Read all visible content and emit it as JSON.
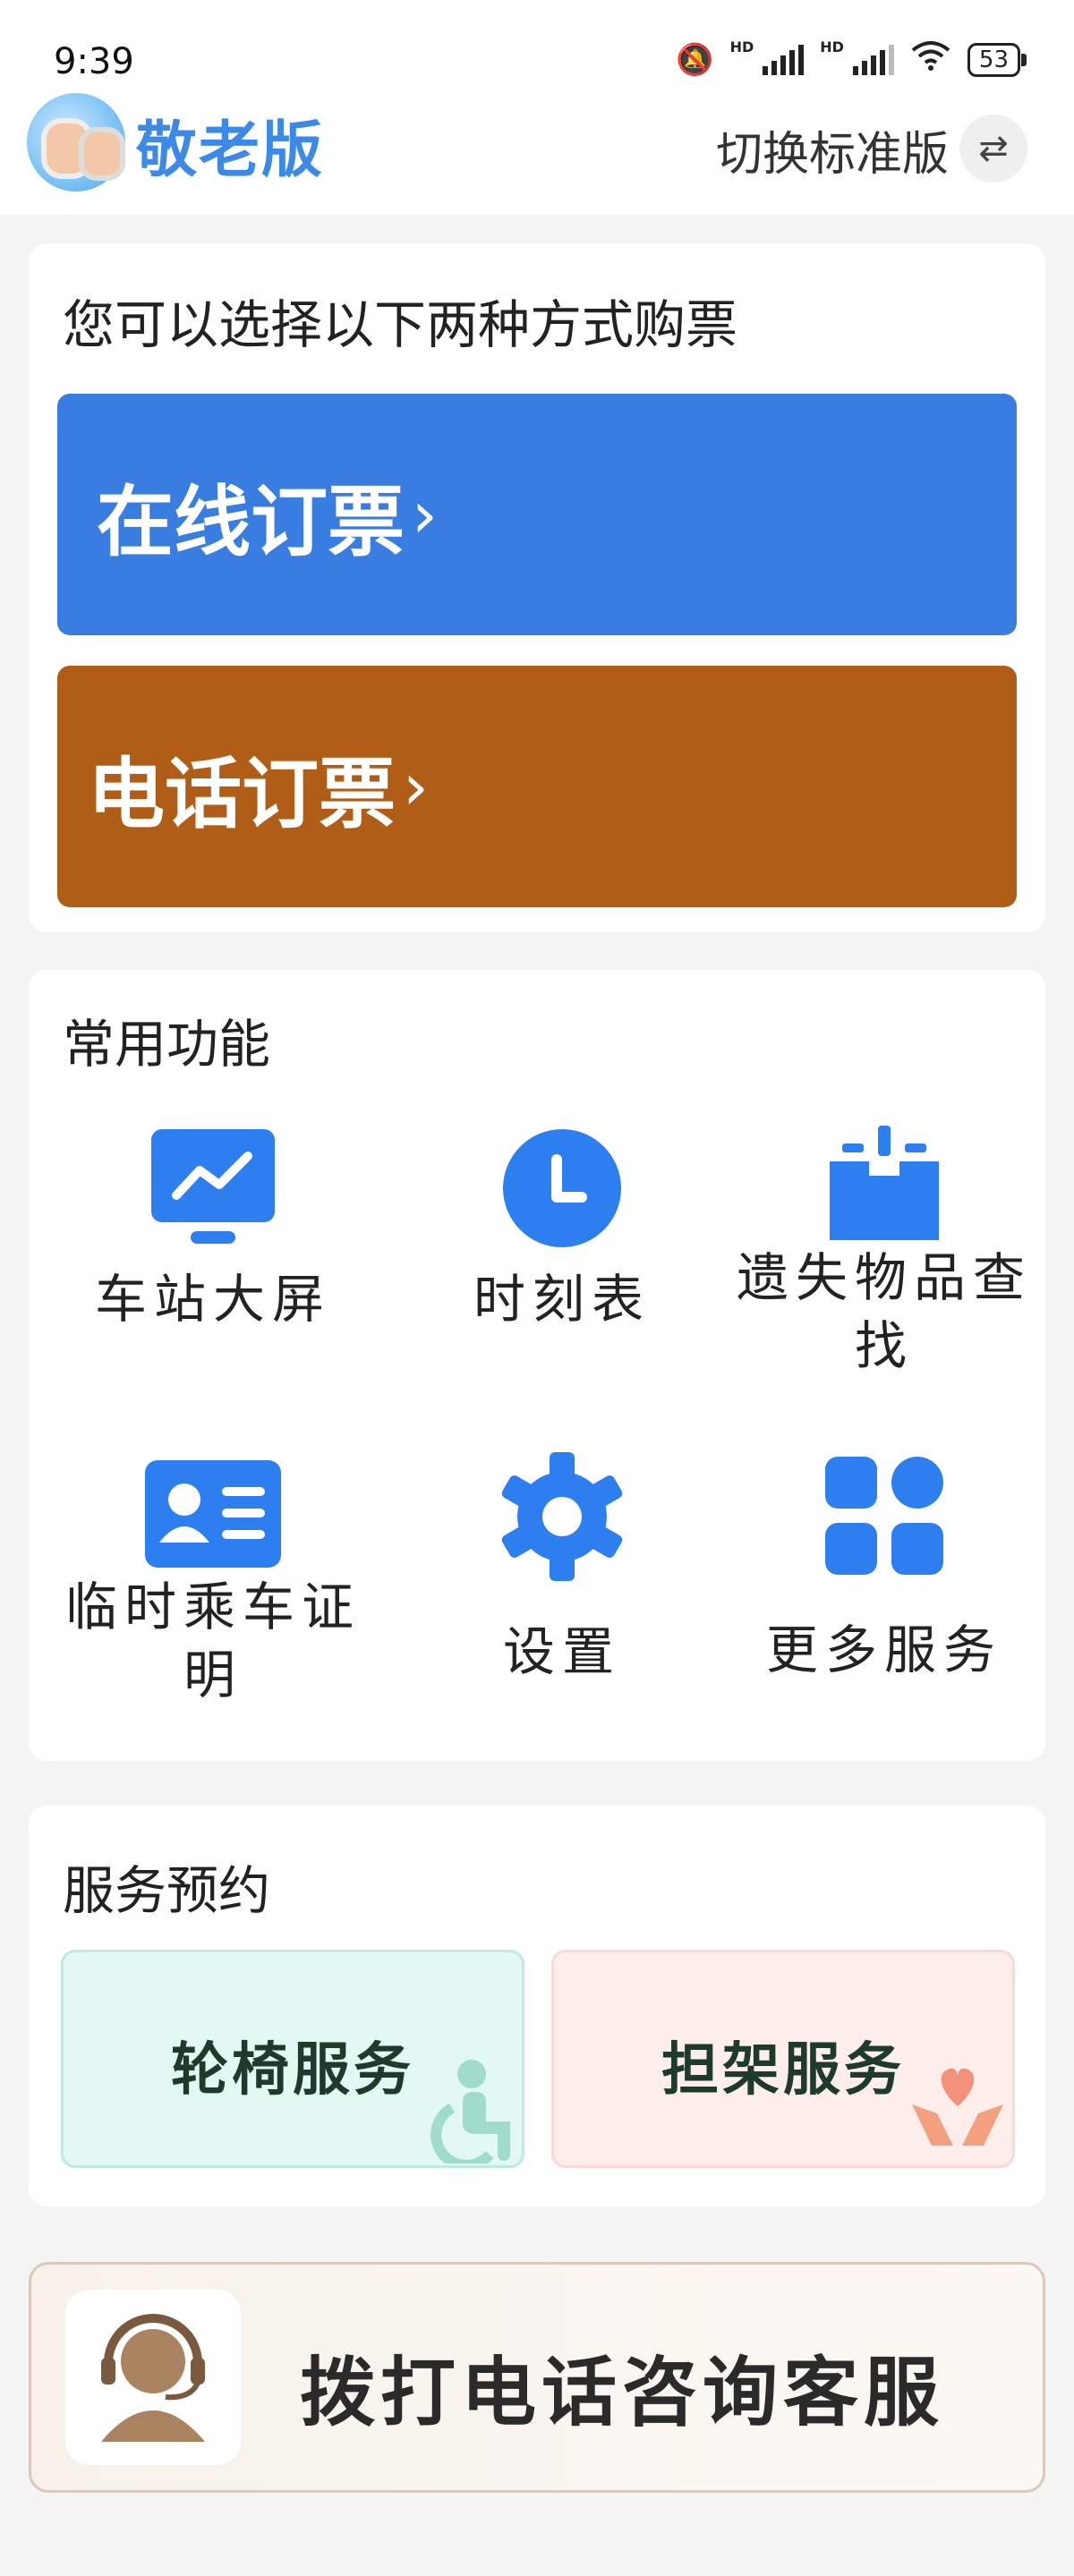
{
  "status_bar": {
    "time": "9:39",
    "battery": "53",
    "hd1": "HD",
    "hd2": "HD"
  },
  "header": {
    "app_title": "敬老版",
    "switch_label": "切换标准版",
    "switch_icon": "swap-arrows-icon"
  },
  "booking": {
    "title": "您可以选择以下两种方式购票",
    "online": {
      "label": "在线订票",
      "color": "#3a7de0"
    },
    "phone": {
      "label": "电话订票",
      "color": "#b05e17"
    },
    "arrow": "›"
  },
  "features": {
    "title": "常用功能",
    "items": [
      {
        "label": "车站大屏",
        "icon": "monitor-chart-icon"
      },
      {
        "label": "时刻表",
        "icon": "clock-icon"
      },
      {
        "label": "遗失物品查找",
        "icon": "lost-box-icon"
      },
      {
        "label": "临时乘车证明",
        "icon": "id-card-icon"
      },
      {
        "label": "设置",
        "icon": "gear-icon"
      },
      {
        "label": "更多服务",
        "icon": "grid-apps-icon"
      }
    ]
  },
  "services": {
    "title": "服务预约",
    "wheelchair": {
      "label": "轮椅服务",
      "icon": "wheelchair-icon"
    },
    "stretcher": {
      "label": "担架服务",
      "icon": "heart-hands-icon"
    }
  },
  "hotline": {
    "label": "拨打电话咨询客服",
    "icon": "headset-agent-icon"
  }
}
